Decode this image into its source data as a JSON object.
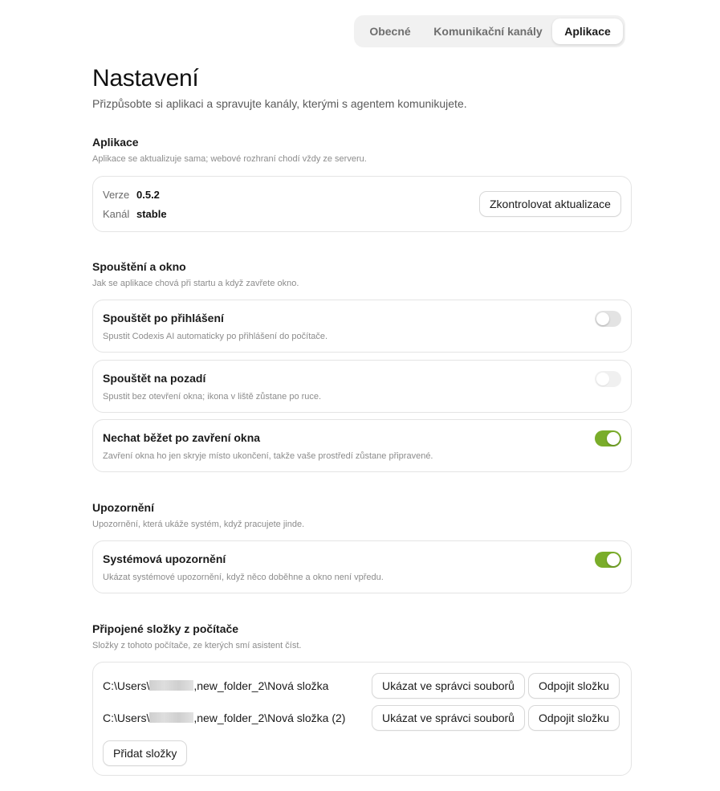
{
  "tabs": [
    {
      "label": "Obecné",
      "active": false
    },
    {
      "label": "Komunikační kanály",
      "active": false
    },
    {
      "label": "Aplikace",
      "active": true
    }
  ],
  "page": {
    "title": "Nastavení",
    "subtitle": "Přizpůsobte si aplikaci a spravujte kanály, kterými s agentem komunikujete."
  },
  "app_section": {
    "title": "Aplikace",
    "description": "Aplikace se aktualizuje sama; webové rozhraní chodí vždy ze serveru.",
    "version_label": "Verze",
    "version_value": "0.5.2",
    "channel_label": "Kanál",
    "channel_value": "stable",
    "check_updates_button": "Zkontrolovat aktualizace"
  },
  "startup_section": {
    "title": "Spouštění a okno",
    "description": "Jak se aplikace chová při startu a když zavřete okno.",
    "items": [
      {
        "title": "Spouštět po přihlášení",
        "description": "Spustit Codexis AI automaticky po přihlášení do počítače.",
        "enabled": false
      },
      {
        "title": "Spouštět na pozadí",
        "description": "Spustit bez otevření okna; ikona v liště zůstane po ruce.",
        "enabled": false,
        "disabled": true
      },
      {
        "title": "Nechat běžet po zavření okna",
        "description": "Zavření okna ho jen skryje místo ukončení, takže vaše prostředí zůstane připravené.",
        "enabled": true
      }
    ]
  },
  "notifications_section": {
    "title": "Upozornění",
    "description": "Upozornění, která ukáže systém, když pracujete jinde.",
    "items": [
      {
        "title": "Systémová upozornění",
        "description": "Ukázat systémové upozornění, když něco doběhne a okno není vpředu.",
        "enabled": true
      }
    ]
  },
  "folders_section": {
    "title": "Připojené složky z počítače",
    "description": "Složky z tohoto počítače, ze kterých smí asistent číst.",
    "folders": [
      {
        "path_prefix": "C:\\Users\\",
        "path_suffix": ",new_folder_2\\Nová složka",
        "show_button": "Ukázat ve správci souborů",
        "disconnect_button": "Odpojit složku"
      },
      {
        "path_prefix": "C:\\Users\\",
        "path_suffix": ",new_folder_2\\Nová složka (2)",
        "show_button": "Ukázat ve správci souborů",
        "disconnect_button": "Odpojit složku"
      }
    ],
    "add_button": "Přidat složky"
  },
  "colors": {
    "toggle_on": "#7aad2a",
    "toggle_off": "#e3e3e3"
  }
}
